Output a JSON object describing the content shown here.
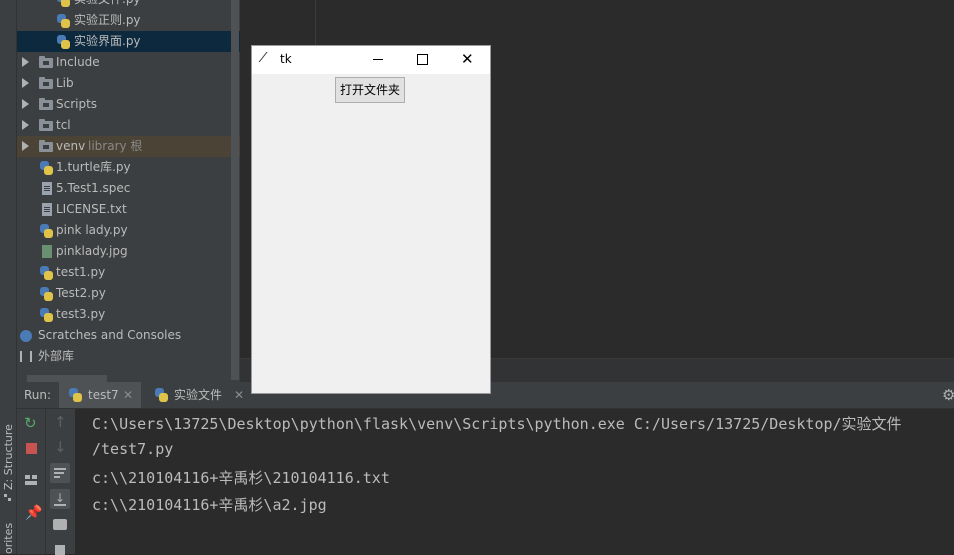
{
  "sidebar_strip": {
    "structure_label": "Z: Structure",
    "favorites_label": "orites"
  },
  "tree": {
    "items": [
      {
        "label": "实验文件.py",
        "type": "py"
      },
      {
        "label": "实验正则.py",
        "type": "py"
      },
      {
        "label": "实验界面.py",
        "type": "py",
        "selected": true
      },
      {
        "label": "Include",
        "type": "folder"
      },
      {
        "label": "Lib",
        "type": "folder"
      },
      {
        "label": "Scripts",
        "type": "folder"
      },
      {
        "label": "tcl",
        "type": "folder"
      },
      {
        "label": "venv",
        "suffix": "library 根",
        "type": "folder",
        "highlight": true
      },
      {
        "label": "1.turtle库.py",
        "type": "py"
      },
      {
        "label": "5.Test1.spec",
        "type": "file"
      },
      {
        "label": "LICENSE.txt",
        "type": "file"
      },
      {
        "label": "pink lady.py",
        "type": "py"
      },
      {
        "label": "pinklady.jpg",
        "type": "image"
      },
      {
        "label": "test1.py",
        "type": "py"
      },
      {
        "label": "Test2.py",
        "type": "py"
      },
      {
        "label": "test3.py",
        "type": "py"
      },
      {
        "label": "Scratches and Consoles",
        "type": "scratches"
      },
      {
        "label": "外部库",
        "type": "libs"
      }
    ]
  },
  "run": {
    "label": "Run:",
    "tabs": [
      {
        "label": "test7",
        "active": true
      },
      {
        "label": "实验文件",
        "active": false
      }
    ]
  },
  "console": {
    "lines": [
      "C:\\Users\\13725\\Desktop\\python\\flask\\venv\\Scripts\\python.exe C:/Users/13725/Desktop/实验文件",
      " /test7.py",
      "c:\\\\210104116+辛禹杉\\210104116.txt",
      "c:\\\\210104116+辛禹杉\\a2.jpg"
    ]
  },
  "tk_window": {
    "title": "tk",
    "button_label": "打开文件夹"
  },
  "colors": {
    "selected_row": "#0d293e",
    "highlight_row": "#4b4336",
    "accent_blue": "#4a7bb7"
  }
}
